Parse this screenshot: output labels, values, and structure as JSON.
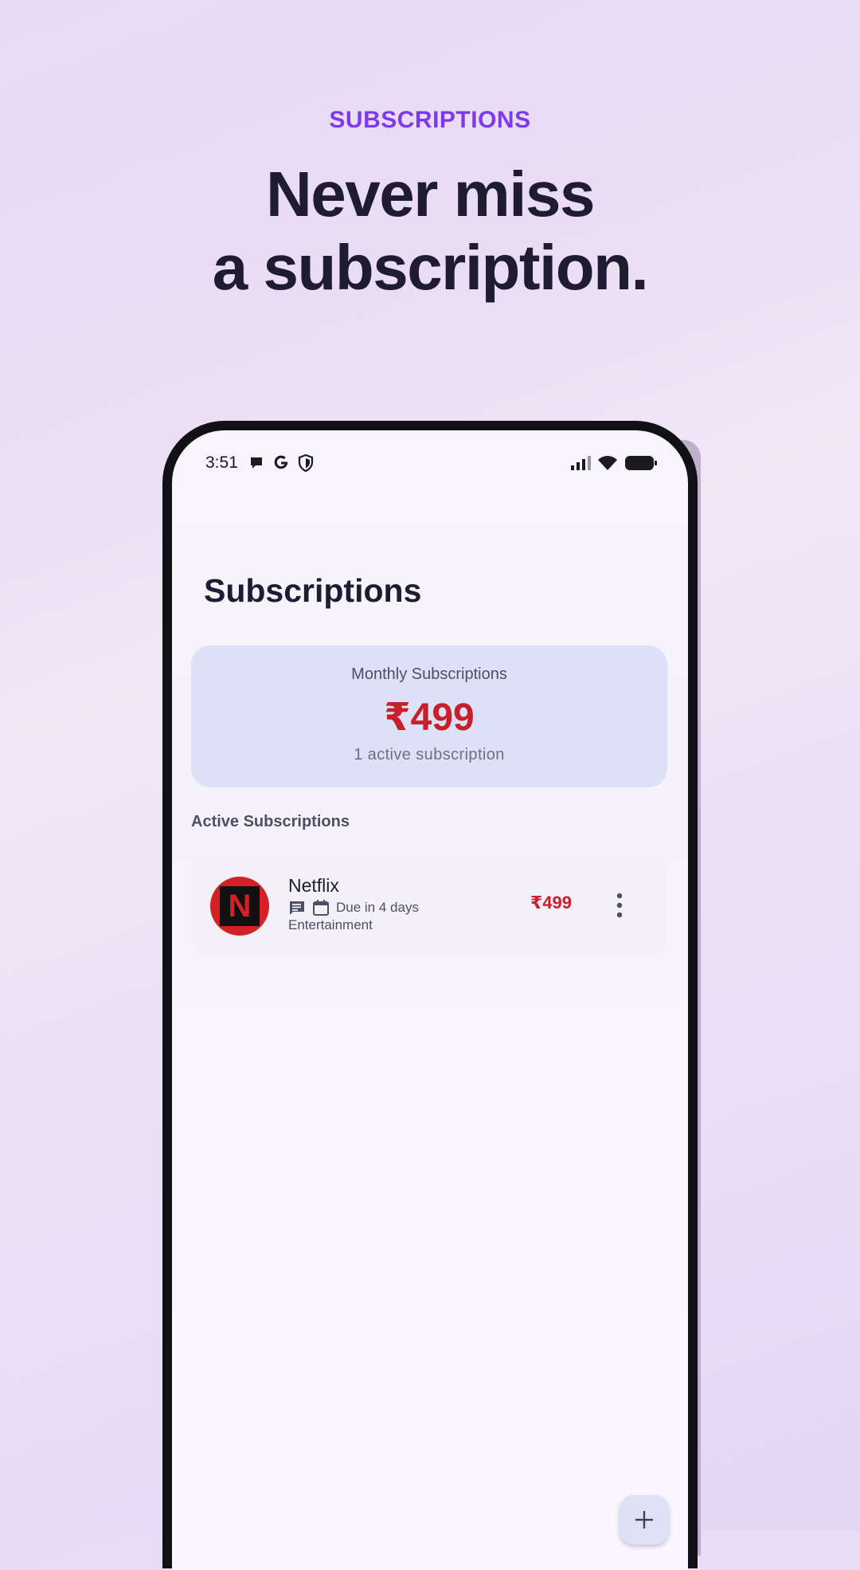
{
  "hero": {
    "eyebrow": "SUBSCRIPTIONS",
    "headline_line1": "Never miss",
    "headline_line2": "a subscription."
  },
  "statusbar": {
    "time": "3:51",
    "left_icons": [
      "message-icon",
      "google-icon",
      "shield-icon"
    ],
    "right_icons": [
      "signal-icon",
      "wifi-icon",
      "battery-icon"
    ]
  },
  "app": {
    "title": "Subscriptions",
    "summary": {
      "label": "Monthly Subscriptions",
      "amount": "₹499",
      "sub": "1 active subscription"
    },
    "section_title": "Active Subscriptions",
    "subscriptions": [
      {
        "logo_letter": "N",
        "name": "Netflix",
        "due": "Due in 4 days",
        "category": "Entertainment",
        "price": "₹499",
        "icons": [
          "notes-icon",
          "calendar-icon",
          "more-vert-icon"
        ]
      }
    ],
    "fab_icon": "plus-icon"
  },
  "colors": {
    "accent": "#7c3aed",
    "amount_red": "#c8202b",
    "card_bg": "#dce1f8",
    "heading": "#1e1b32"
  }
}
